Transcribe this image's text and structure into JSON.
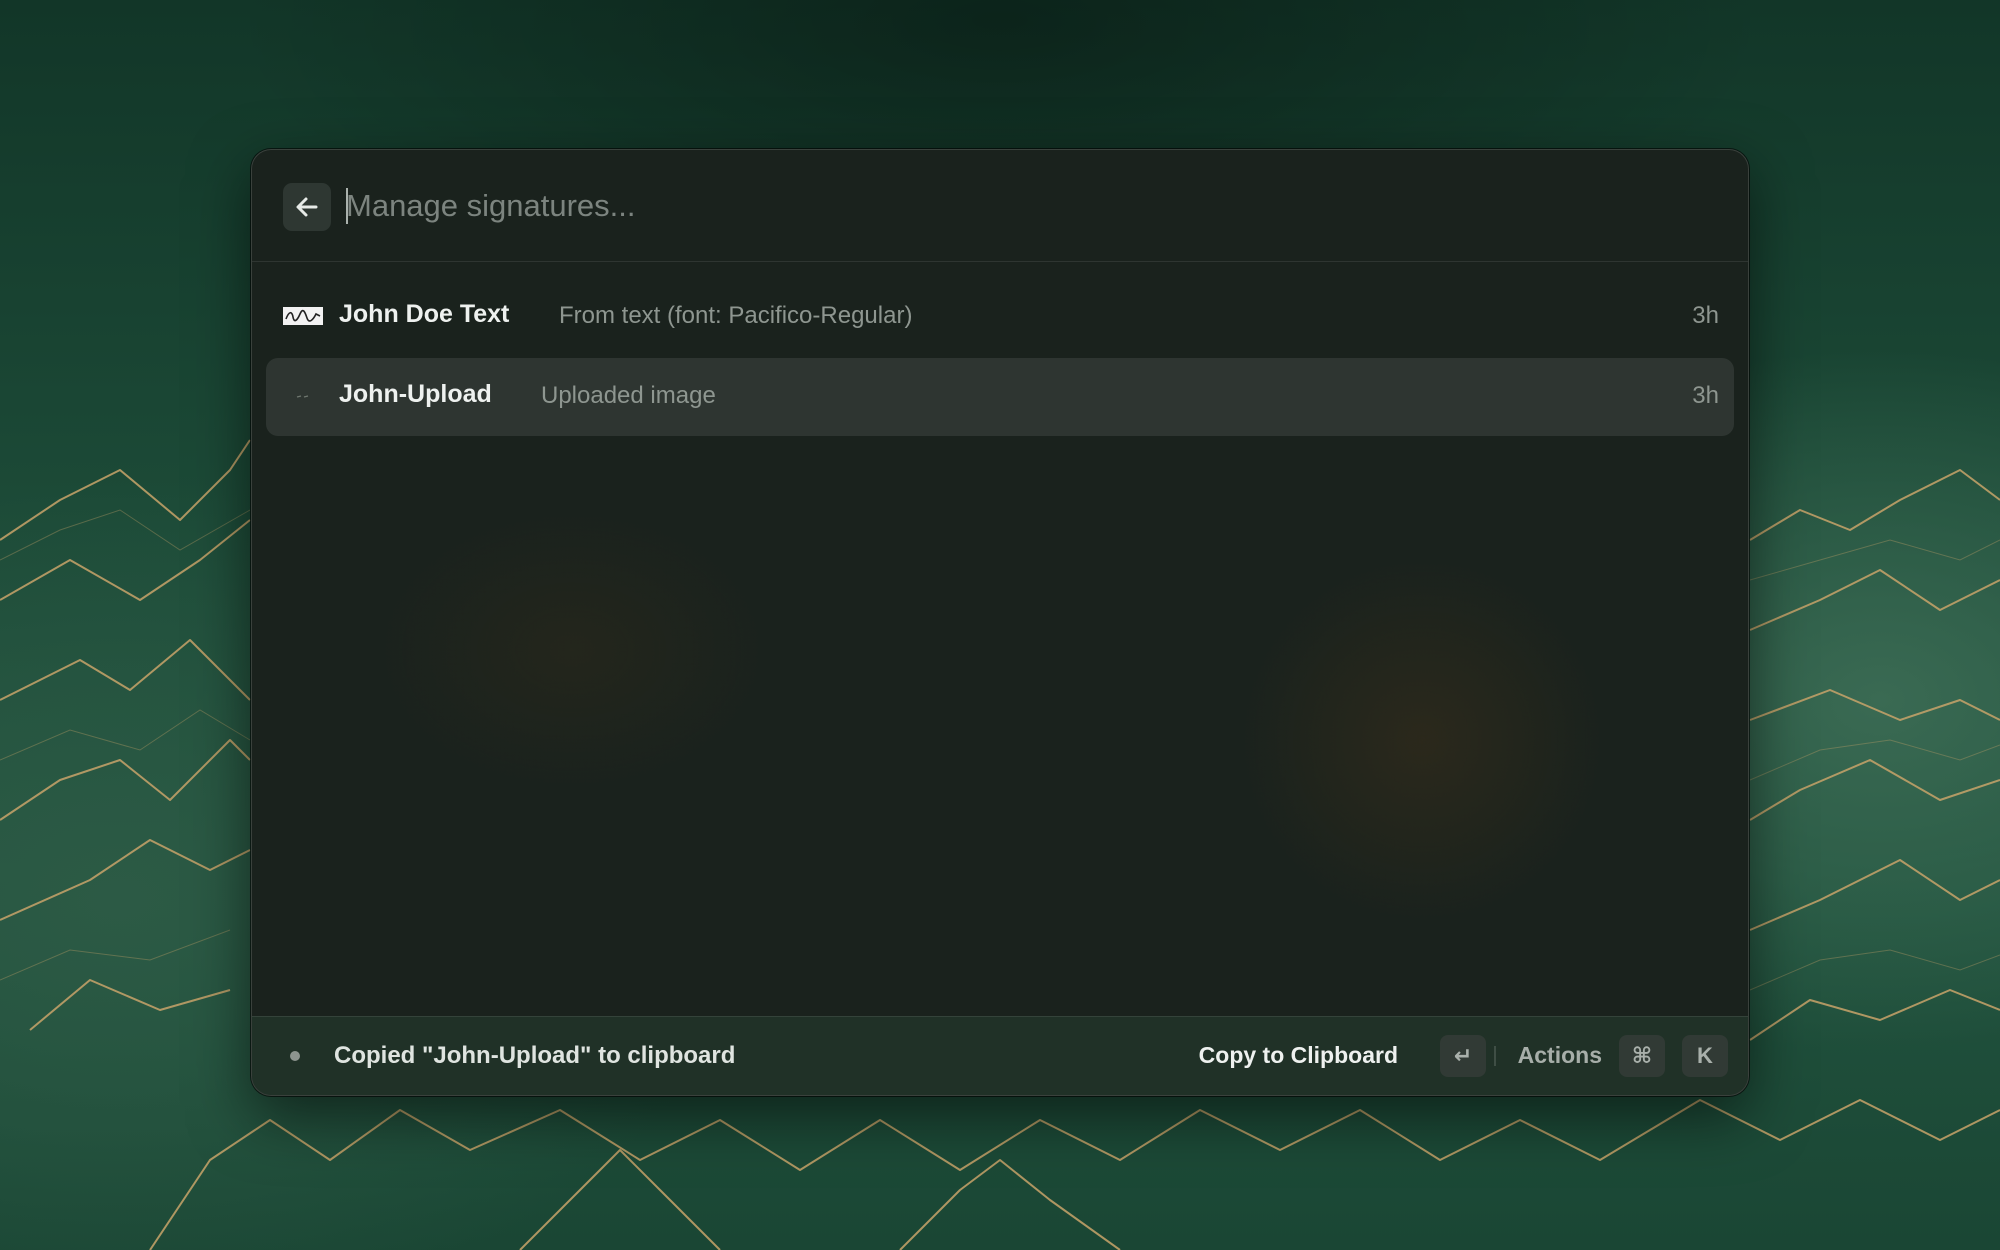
{
  "search": {
    "placeholder": "Manage signatures...",
    "value": ""
  },
  "items": [
    {
      "title": "John Doe Text",
      "subtitle": "From text (font: Pacifico-Regular)",
      "accessory": "3h",
      "selected": false
    },
    {
      "title": "John-Upload",
      "subtitle": "Uploaded image",
      "accessory": "3h",
      "selected": true
    }
  ],
  "footer": {
    "toast": "Copied \"John-Upload\" to clipboard",
    "primary_action": "Copy to Clipboard",
    "enter_key": "↵",
    "actions_label": "Actions",
    "cmd_key": "⌘",
    "k_key": "K"
  },
  "icons": {
    "back": "arrow-left-icon",
    "thumb_text": "signature-thumbnail-icon",
    "thumb_image": "signature-image-icon"
  },
  "colors": {
    "window_bg": "#1a221d",
    "selected_row": "#2a332e",
    "accent_gold": "#c9a46a",
    "wallpaper_green": "#1c4a37"
  }
}
